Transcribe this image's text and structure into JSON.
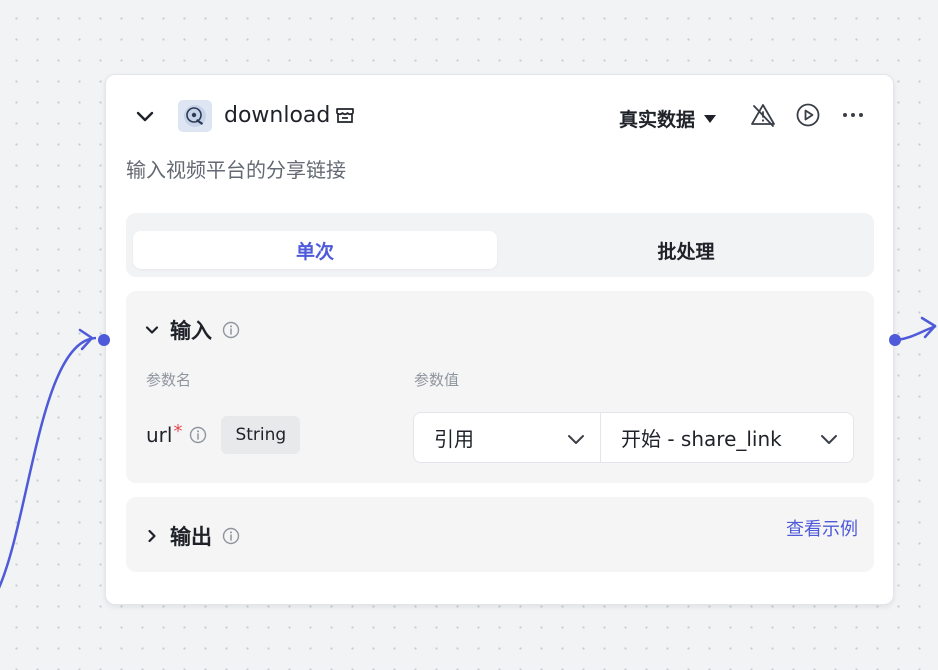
{
  "node": {
    "title": "download",
    "description": "输入视频平台的分享链接",
    "data_source": "真实数据",
    "tabs": [
      {
        "label": "单次",
        "active": true
      },
      {
        "label": "批处理",
        "active": false
      }
    ]
  },
  "input_section": {
    "label": "输入",
    "columns": {
      "name": "参数名",
      "value": "参数值"
    },
    "params": [
      {
        "name": "url",
        "required_mark": "*",
        "type": "String",
        "mode": "引用",
        "value": "开始 - share_link"
      }
    ]
  },
  "output_section": {
    "label": "输出",
    "example_link": "查看示例"
  },
  "colors": {
    "accent": "#4e5ad9",
    "canvas": "#f2f3f5",
    "panel": "#f5f5f6",
    "required": "#e5484d"
  },
  "icons": [
    "chevron-down-icon",
    "plugin-logo",
    "store-icon",
    "triangle-down-icon",
    "warning-off-icon",
    "play-circle-icon",
    "more-icon",
    "info-icon",
    "chevron-right-icon"
  ]
}
